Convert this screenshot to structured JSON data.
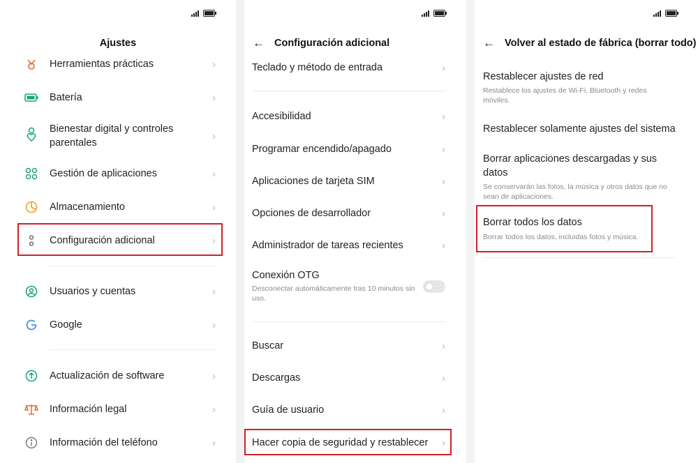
{
  "colors": {
    "highlight": "#d21f26",
    "accent": "#1aa37a"
  },
  "panel1": {
    "title": "Ajustes",
    "items": [
      {
        "label": "Herramientas prácticas",
        "icon": "tools-icon"
      },
      {
        "label": "Batería",
        "icon": "battery-icon"
      },
      {
        "label": "Bienestar digital y controles parentales",
        "icon": "wellbeing-icon"
      },
      {
        "label": "Gestión de aplicaciones",
        "icon": "apps-grid-icon"
      },
      {
        "label": "Almacenamiento",
        "icon": "storage-icon"
      },
      {
        "label": "Configuración adicional",
        "icon": "more-settings-icon"
      },
      {
        "label": "Usuarios y cuentas",
        "icon": "user-icon"
      },
      {
        "label": "Google",
        "icon": "google-icon"
      },
      {
        "label": "Actualización de software",
        "icon": "update-icon"
      },
      {
        "label": "Información legal",
        "icon": "legal-icon"
      },
      {
        "label": "Información del teléfono",
        "icon": "info-icon"
      }
    ]
  },
  "panel2": {
    "title": "Configuración adicional",
    "items": [
      {
        "label": "Teclado y método de entrada"
      },
      {
        "label": "Accesibilidad"
      },
      {
        "label": "Programar encendido/apagado"
      },
      {
        "label": "Aplicaciones de tarjeta SIM"
      },
      {
        "label": "Opciones de desarrollador"
      },
      {
        "label": "Administrador de tareas recientes"
      },
      {
        "label": "Conexión OTG",
        "sub": "Desconectar automáticamente tras 10 minutos sin uso."
      },
      {
        "label": "Buscar"
      },
      {
        "label": "Descargas"
      },
      {
        "label": "Guía de usuario"
      },
      {
        "label": "Hacer copia de seguridad y restablecer"
      }
    ]
  },
  "panel3": {
    "title": "Volver al estado de fábrica (borrar todo)",
    "items": [
      {
        "label": "Restablecer ajustes de red",
        "sub": "Restablece los ajustes de Wi-Fi, Bluetooth y redes móviles."
      },
      {
        "label": "Restablecer solamente ajustes del sistema"
      },
      {
        "label": "Borrar aplicaciones descargadas y sus datos",
        "sub": "Se conservarán las fotos, la música y otros datos que no sean de aplicaciones."
      },
      {
        "label": "Borrar todos los datos",
        "sub": "Borrar todos los datos, incluidas fotos y música."
      }
    ]
  }
}
